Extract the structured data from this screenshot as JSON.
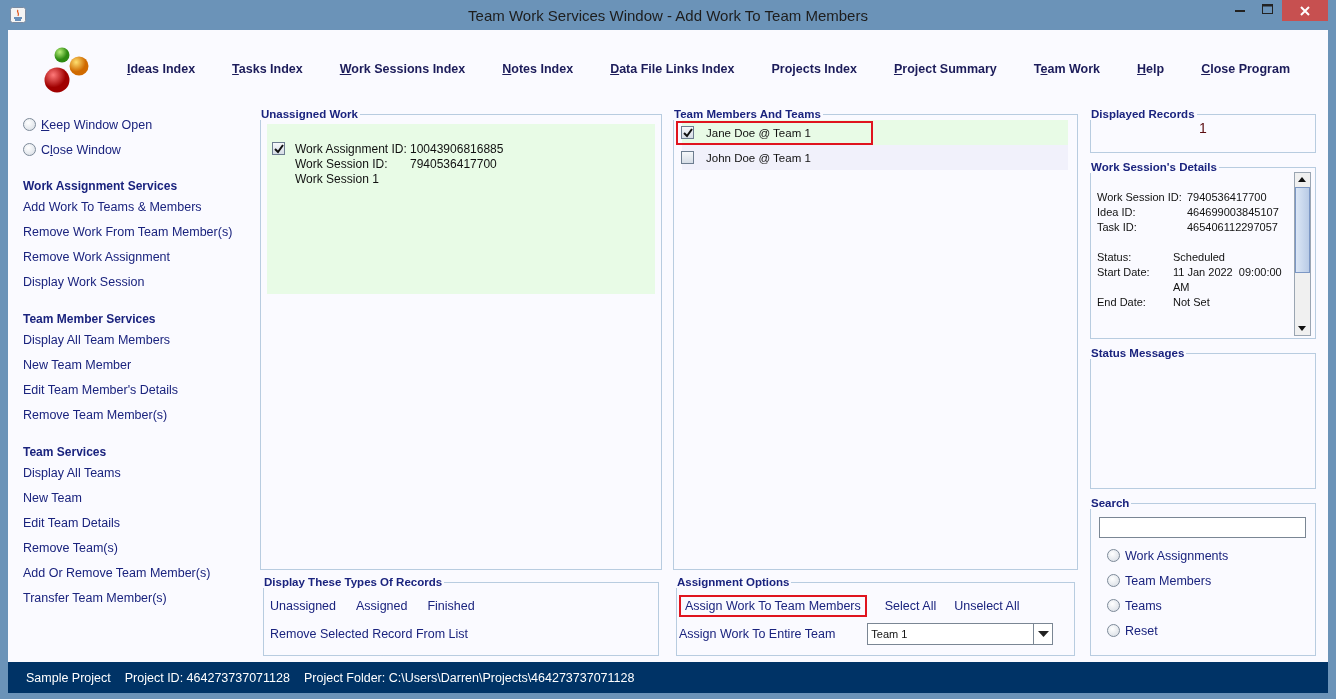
{
  "window": {
    "title": "Team Work Services Window - Add Work To Team Members"
  },
  "menu": [
    {
      "key": "I",
      "post": "deas Index"
    },
    {
      "key": "T",
      "post": "asks Index"
    },
    {
      "key": "W",
      "post": "ork Sessions Index"
    },
    {
      "key": "N",
      "post": "otes Index"
    },
    {
      "key": "D",
      "post": "ata File Links Index"
    },
    {
      "pre": "Projects Index"
    },
    {
      "key": "P",
      "post": "roject Summary"
    },
    {
      "pre": "T",
      "key": "e",
      "post": "am Work"
    },
    {
      "key": "H",
      "post": "elp"
    },
    {
      "key": "C",
      "post": "lose Program"
    }
  ],
  "sidebar": {
    "window_options": [
      {
        "key": "K",
        "post": "eep Window Open",
        "selected": false
      },
      {
        "pre": "C",
        "key": "l",
        "post": "ose Window",
        "selected": false
      }
    ],
    "sections": [
      {
        "heading": "Work Assignment Services",
        "items": [
          "Add Work To Teams & Members",
          "Remove Work From Team Member(s)",
          "Remove Work Assignment",
          "Display Work Session"
        ]
      },
      {
        "heading": "Team Member Services",
        "items": [
          "Display All Team Members",
          "New Team Member",
          "Edit Team Member's Details",
          "Remove Team Member(s)"
        ]
      },
      {
        "heading": "Team Services",
        "items": [
          "Display All Teams",
          "New Team",
          "Edit Team Details",
          "Remove Team(s)",
          "Add Or Remove Team Member(s)",
          "Transfer Team Member(s)"
        ]
      }
    ]
  },
  "unassigned_work": {
    "title": "Unassigned Work",
    "records": [
      {
        "checked": true,
        "fields": [
          {
            "label": "Work Assignment ID:",
            "value": "10043906816885"
          },
          {
            "label": "Work Session ID:",
            "value": "7940536417700"
          }
        ],
        "name": "Work Session 1"
      }
    ]
  },
  "display_types": {
    "title": "Display These Types Of Records",
    "filters": [
      "Unassigned",
      "Assigned",
      "Finished"
    ],
    "remove_button": "Remove Selected Record From List"
  },
  "team_members": {
    "title": "Team Members And Teams",
    "rows": [
      {
        "label": "Jane Doe @ Team 1",
        "checked": true,
        "highlighted": true
      },
      {
        "label": "John Doe @ Team 1",
        "checked": false,
        "highlighted": false
      }
    ]
  },
  "assignment_options": {
    "title": "Assignment Options",
    "buttons": [
      {
        "label": "Assign Work To Team Members",
        "highlighted": true
      },
      {
        "label": "Select All",
        "highlighted": false
      },
      {
        "label": "Unselect All",
        "highlighted": false
      }
    ],
    "entire_team_label": "Assign Work To Entire Team",
    "team_select": "Team 1"
  },
  "displayed_records": {
    "title": "Displayed Records",
    "count": "1"
  },
  "session_details": {
    "title": "Work Session's Details",
    "groups": [
      [
        {
          "label": "Work Session ID:",
          "value": "7940536417700"
        },
        {
          "label": "Idea ID:",
          "value": "464699003845107"
        },
        {
          "label": "Task ID:",
          "value": "465406112297057"
        }
      ],
      [
        {
          "label": "Status:",
          "value": "Scheduled"
        },
        {
          "label": "Start Date:",
          "value": "11 Jan 2022  09:00:00 AM"
        },
        {
          "label": "End Date:",
          "value": "Not Set"
        }
      ]
    ]
  },
  "status_messages": {
    "title": "Status Messages"
  },
  "search": {
    "title": "Search",
    "options": [
      {
        "label": "Work Assignments",
        "selected": false
      },
      {
        "label": "Team Members",
        "selected": false
      },
      {
        "label": "Teams",
        "selected": false
      },
      {
        "label": "Reset",
        "selected": false
      }
    ]
  },
  "status_bar": [
    "Sample Project",
    "Project ID: 464273737071128",
    "Project Folder: C:\\Users\\Darren\\Projects\\464273737071128"
  ]
}
